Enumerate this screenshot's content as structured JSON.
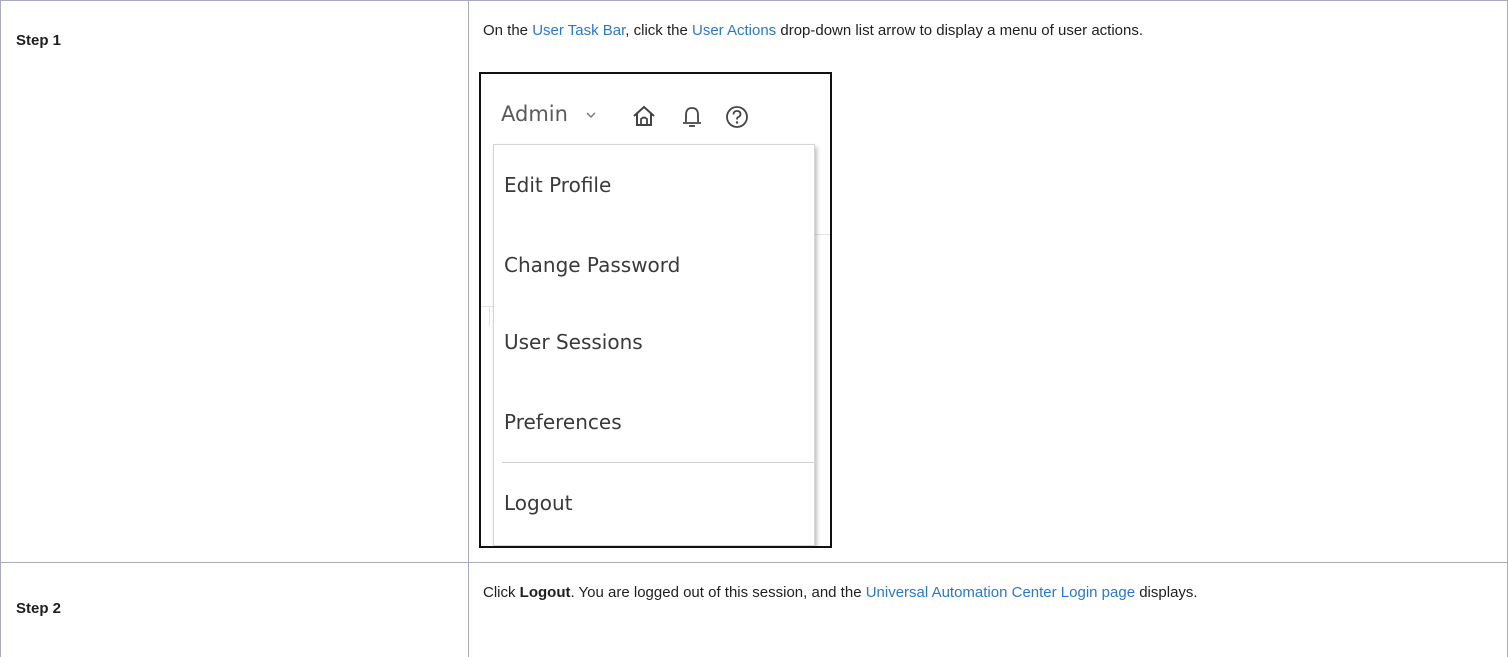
{
  "steps": [
    {
      "label": "Step 1",
      "text": {
        "before": "On the ",
        "link1": "User Task Bar",
        "middle": ", click the ",
        "link2": "User Actions",
        "after": " drop-down list arrow to display a menu of user actions."
      }
    },
    {
      "label": "Step  2",
      "text": {
        "before": "Click ",
        "bold": "Logout",
        "middle": ". You are logged out of this session, and the ",
        "link": "Universal Automation Center Login page",
        "after": " displays."
      }
    }
  ],
  "screenshot": {
    "user_label": "Admin",
    "icons": [
      "chevron-down-icon",
      "home-icon",
      "bell-icon",
      "help-icon"
    ],
    "menu_items": [
      "Edit Profile",
      "Change Password",
      "User Sessions",
      "Preferences",
      "Logout"
    ]
  },
  "colors": {
    "link": "#2a78c8",
    "border": "#a9a9c4",
    "text": "#1f1f1f"
  }
}
